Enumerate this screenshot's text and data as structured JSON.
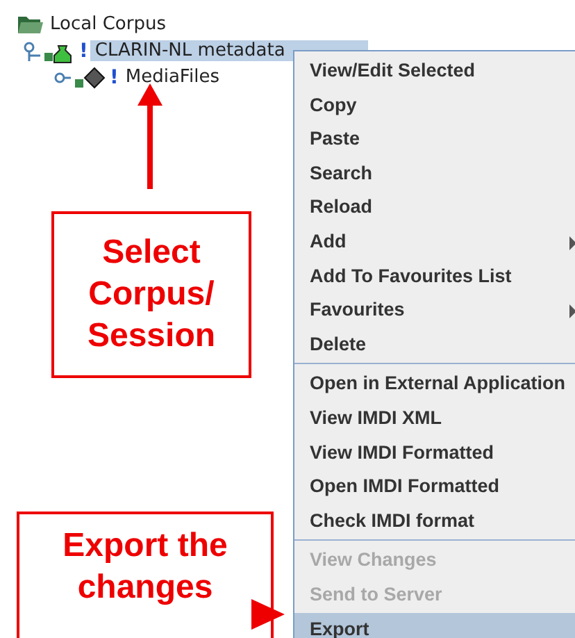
{
  "tree": {
    "label": "Local Corpus",
    "children": [
      {
        "label": "CLARIN-NL metadata",
        "kind": "corpus",
        "flag": "!",
        "selected": true,
        "expanded": true,
        "children": [
          {
            "label": "MediaFiles",
            "kind": "folder",
            "flag": "!",
            "selected": false,
            "expanded": false
          }
        ]
      }
    ]
  },
  "context_menu": {
    "groups": [
      [
        {
          "label": "View/Edit Selected",
          "submenu": false,
          "disabled": false,
          "selected": false
        },
        {
          "label": "Copy",
          "submenu": false,
          "disabled": false,
          "selected": false
        },
        {
          "label": "Paste",
          "submenu": false,
          "disabled": false,
          "selected": false
        },
        {
          "label": "Search",
          "submenu": false,
          "disabled": false,
          "selected": false
        },
        {
          "label": "Reload",
          "submenu": false,
          "disabled": false,
          "selected": false
        },
        {
          "label": "Add",
          "submenu": true,
          "disabled": false,
          "selected": false
        },
        {
          "label": "Add To Favourites List",
          "submenu": false,
          "disabled": false,
          "selected": false
        },
        {
          "label": "Favourites",
          "submenu": true,
          "disabled": false,
          "selected": false
        },
        {
          "label": "Delete",
          "submenu": false,
          "disabled": false,
          "selected": false
        }
      ],
      [
        {
          "label": "Open in External Application",
          "submenu": false,
          "disabled": false,
          "selected": false
        },
        {
          "label": "View IMDI XML",
          "submenu": false,
          "disabled": false,
          "selected": false
        },
        {
          "label": "View IMDI Formatted",
          "submenu": false,
          "disabled": false,
          "selected": false
        },
        {
          "label": "Open IMDI Formatted",
          "submenu": false,
          "disabled": false,
          "selected": false
        },
        {
          "label": "Check IMDI format",
          "submenu": false,
          "disabled": false,
          "selected": false
        }
      ],
      [
        {
          "label": "View Changes",
          "submenu": false,
          "disabled": true,
          "selected": false
        },
        {
          "label": "Send to Server",
          "submenu": false,
          "disabled": true,
          "selected": false
        },
        {
          "label": "Export",
          "submenu": false,
          "disabled": false,
          "selected": true
        }
      ]
    ]
  },
  "callouts": [
    {
      "text": "Select Corpus/ Session",
      "kind": "up"
    },
    {
      "text": "Export the changes",
      "kind": "right"
    }
  ]
}
